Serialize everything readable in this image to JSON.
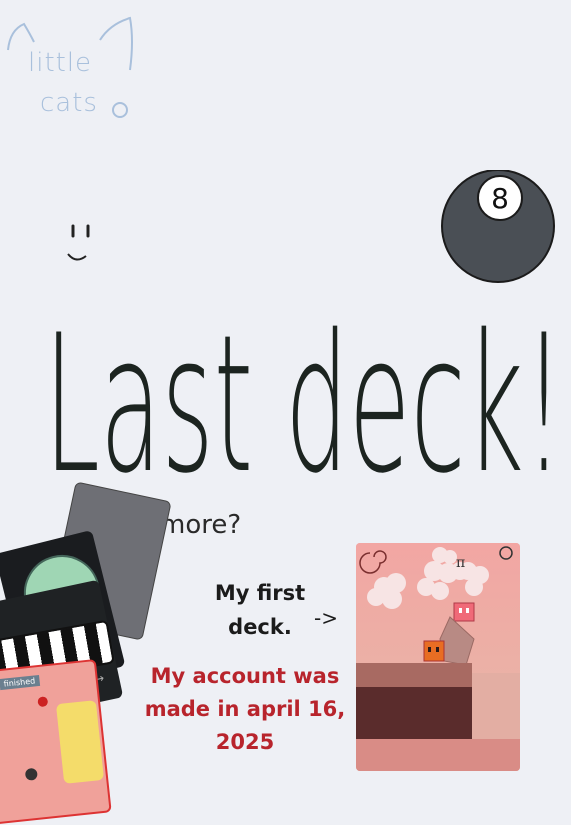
{
  "logo": {
    "line1": "little",
    "line2": "cats"
  },
  "headline": "Last deck!",
  "more_note": "more?",
  "first_deck_line1": "My first",
  "first_deck_line2": "deck.",
  "arrow": "->",
  "account_lines": [
    "My account was",
    "made in april 16,",
    "2025"
  ],
  "eight_ball": {
    "number": "8"
  },
  "game_preview": {
    "pi_symbol": "π"
  },
  "card_status_text": "finished",
  "colors": {
    "background": "#eef0f5",
    "headline": "#1c2420",
    "account_text": "#b8242c",
    "logo": "#a9c0dc"
  }
}
